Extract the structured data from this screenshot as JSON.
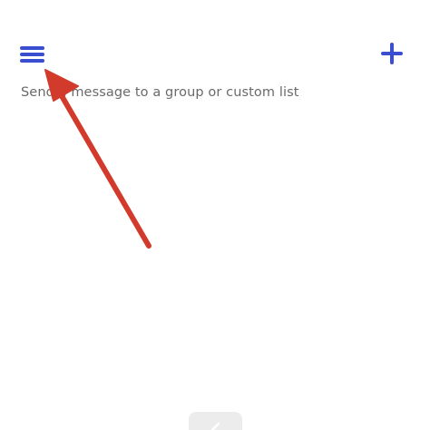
{
  "header": {
    "menu_icon": "hamburger-menu-icon",
    "add_icon": "plus-icon",
    "accent_color": "#3a4fd0"
  },
  "main": {
    "subtitle": "Send a message to a group or custom list"
  },
  "annotation": {
    "arrow_color": "#d23a2c"
  },
  "bottom": {
    "compose_icon": "compose-icon"
  }
}
